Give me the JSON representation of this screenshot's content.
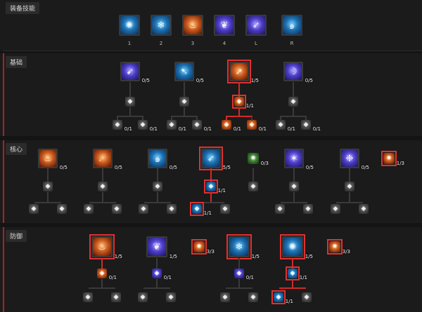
{
  "sections": {
    "equip": "装备技能",
    "basic": "基础",
    "core": "核心",
    "defense": "防御"
  },
  "slots": [
    {
      "label": "1",
      "icon": "frost-burst-icon",
      "theme": "blue"
    },
    {
      "label": "2",
      "icon": "ice-shield-icon",
      "theme": "blue"
    },
    {
      "label": "3",
      "icon": "fire-shield-icon",
      "theme": "orange"
    },
    {
      "label": "4",
      "icon": "frost-tree-icon",
      "theme": "purple"
    },
    {
      "label": "L",
      "icon": "ice-shard-icon",
      "theme": "purple"
    },
    {
      "label": "R",
      "icon": "frost-vortex-icon",
      "theme": "blue"
    }
  ],
  "basic": {
    "skills": [
      {
        "rank": "0/5",
        "icon": "frost-bolt-icon",
        "theme": "purple"
      },
      {
        "rank": "0/5",
        "icon": "spark-icon",
        "theme": "blue"
      },
      {
        "rank": "1/5",
        "icon": "fire-bolt-icon",
        "theme": "orange"
      },
      {
        "rank": "0/5",
        "icon": "arc-lash-icon",
        "theme": "purple"
      }
    ],
    "upgrades": [
      {
        "rank": ""
      },
      {
        "rank": ""
      },
      {
        "rank": "1/1"
      },
      {
        "rank": ""
      }
    ],
    "branches": [
      {
        "rank": "0/1"
      },
      {
        "rank": "0/1"
      },
      {
        "rank": "0/1"
      },
      {
        "rank": "0/1"
      },
      {
        "rank": "0/1"
      },
      {
        "rank": "0/1"
      },
      {
        "rank": "0/1"
      },
      {
        "rank": "0/1"
      }
    ]
  },
  "core": {
    "skills": [
      {
        "rank": "0/5",
        "icon": "incinerate-icon",
        "theme": "orange"
      },
      {
        "rank": "0/5",
        "icon": "fireball-icon",
        "theme": "orange"
      },
      {
        "rank": "0/5",
        "icon": "charged-bolt-icon",
        "theme": "blue"
      },
      {
        "rank": "5/5",
        "icon": "frozen-orb-icon",
        "theme": "blue"
      },
      {
        "rank": "0/3",
        "icon": "passive-node-icon",
        "theme": "green"
      },
      {
        "rank": "0/5",
        "icon": "chain-lightning-icon",
        "theme": "purple"
      },
      {
        "rank": "0/5",
        "icon": "ice-shards-icon",
        "theme": "purple"
      },
      {
        "rank": "1/3",
        "icon": "passive-node-icon",
        "theme": "orange"
      }
    ],
    "upgrades": [
      {
        "rank": ""
      },
      {
        "rank": ""
      },
      {
        "rank": ""
      },
      {
        "rank": "1/1"
      },
      {
        "rank": ""
      },
      {
        "rank": ""
      },
      {
        "rank": ""
      }
    ],
    "branches": [
      {
        "rank": ""
      },
      {
        "rank": ""
      },
      {
        "rank": ""
      },
      {
        "rank": ""
      },
      {
        "rank": ""
      },
      {
        "rank": ""
      },
      {
        "rank": "1/1"
      },
      {
        "rank": ""
      },
      {
        "rank": ""
      },
      {
        "rank": ""
      },
      {
        "rank": ""
      },
      {
        "rank": ""
      }
    ]
  },
  "defense": {
    "skills": [
      {
        "rank": "1/5",
        "icon": "flame-shield-icon",
        "theme": "orange"
      },
      {
        "rank": "1/5",
        "icon": "teleport-icon",
        "theme": "purple"
      },
      {
        "rank": "3/3",
        "icon": "passive-node-icon",
        "theme": "orange"
      },
      {
        "rank": "1/5",
        "icon": "ice-armor-icon",
        "theme": "blue"
      },
      {
        "rank": "1/5",
        "icon": "frost-nova-icon",
        "theme": "blue"
      },
      {
        "rank": "3/3",
        "icon": "passive-node-icon",
        "theme": "orange"
      }
    ],
    "upgrades": [
      {
        "rank": "0/1"
      },
      {
        "rank": "0/1"
      },
      {
        "rank": "0/1"
      },
      {
        "rank": "1/1"
      }
    ],
    "branches": [
      {
        "rank": ""
      },
      {
        "rank": ""
      },
      {
        "rank": ""
      },
      {
        "rank": ""
      },
      {
        "rank": ""
      },
      {
        "rank": ""
      },
      {
        "rank": "1/1"
      },
      {
        "rank": ""
      }
    ]
  }
}
